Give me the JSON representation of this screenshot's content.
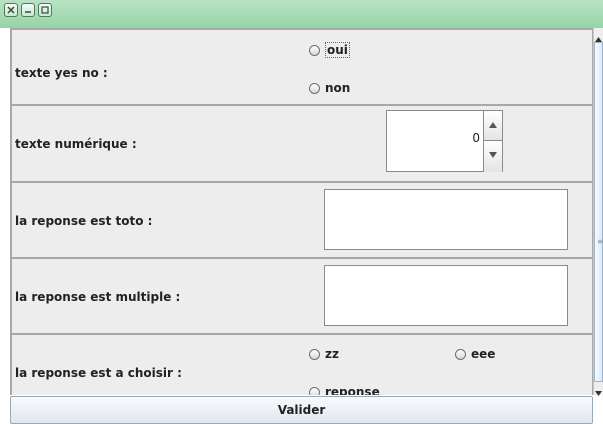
{
  "window": {
    "buttons": [
      "close-icon",
      "minimize-icon",
      "maximize-icon"
    ]
  },
  "form": {
    "rows": [
      {
        "label": "texte yes no :",
        "type": "radio",
        "options": [
          "oui",
          "non"
        ]
      },
      {
        "label": "texte numérique :",
        "type": "spinner",
        "value": "0"
      },
      {
        "label": "la reponse est toto :",
        "type": "text",
        "value": ""
      },
      {
        "label": "la reponse est multiple :",
        "type": "text",
        "value": ""
      },
      {
        "label": "la reponse est a choisir  :",
        "type": "radio",
        "options": [
          "zz",
          "eee",
          "reponse"
        ]
      }
    ]
  },
  "footer": {
    "submit_label": "Valider"
  },
  "colors": {
    "titlebar": "#a7dbb6",
    "panel": "#ededed",
    "border": "#a8a8a8"
  }
}
